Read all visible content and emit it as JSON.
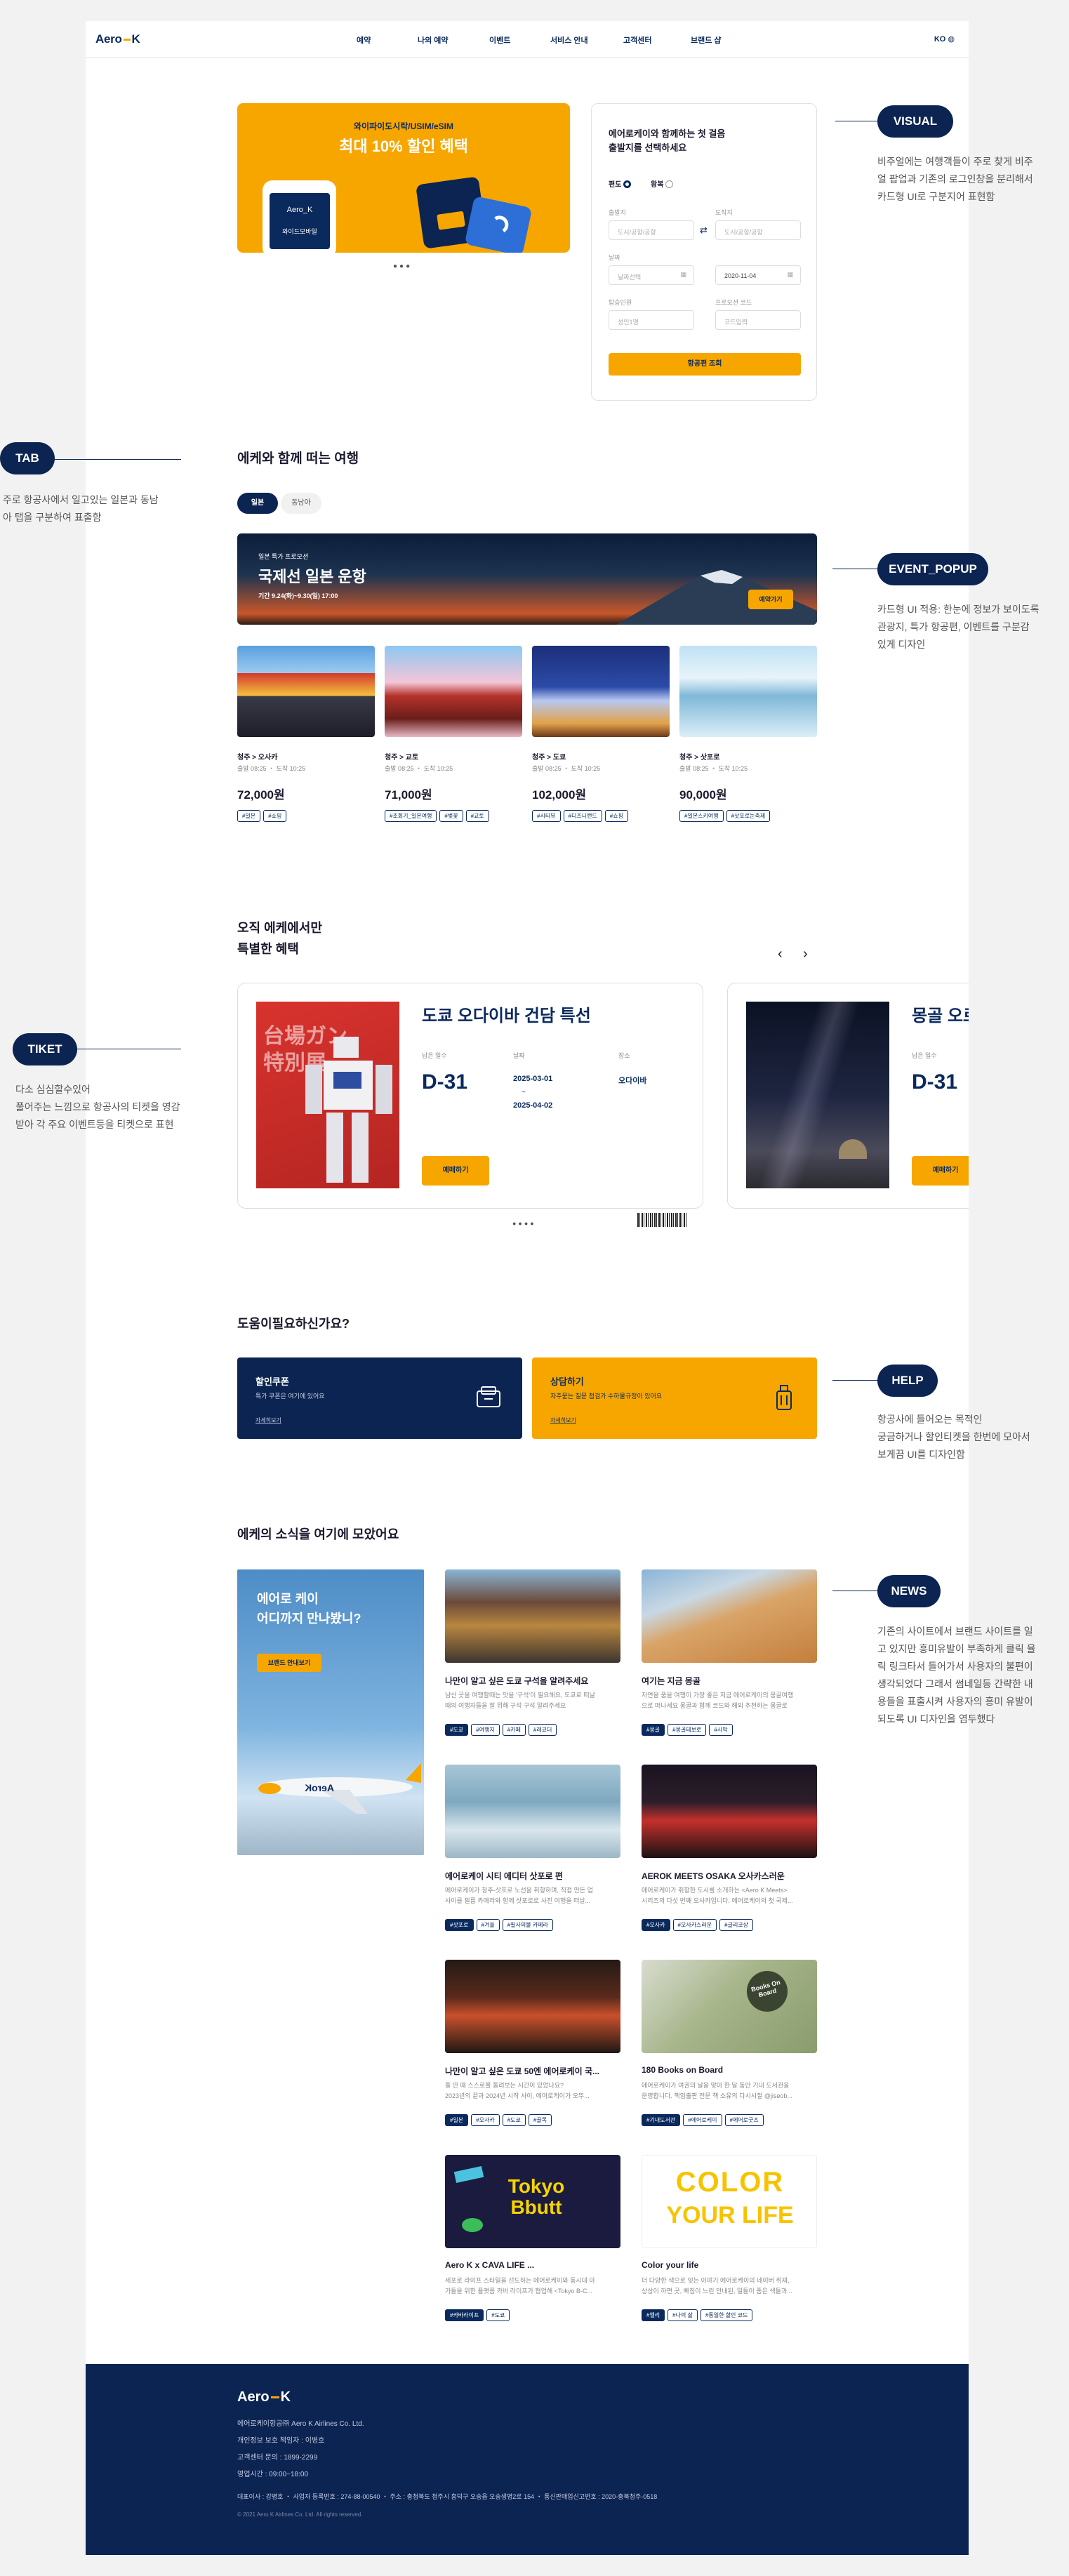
{
  "nav": {
    "logo_left": "Aero",
    "logo_right": "K",
    "menu": [
      "예약",
      "나의 예약",
      "이벤트",
      "서비스 안내",
      "고객센터",
      "브랜드 샵"
    ],
    "lang": "KO"
  },
  "banner": {
    "subtitle": "와이파이도시락/USIM/eSIM",
    "title": "최대 10% 할인 혜택",
    "phone_label_top": "Aero_K",
    "phone_label_bottom": "와이드모바일"
  },
  "booking": {
    "title_line1": "에어로케이와 함께하는 첫 걸음",
    "title_line2": "출발지를 선택하세요",
    "trip_oneway": "편도",
    "trip_round": "왕복",
    "from_label": "출발지",
    "from_placeholder": "도시/공항/공항",
    "to_label": "도착지",
    "to_placeholder": "도시/공항/공항",
    "date_label": "날짜",
    "date1": "날짜선택",
    "date2": "2020-11-04",
    "pax_label": "탑승인원",
    "pax_value": "성인1명",
    "promo_label": "프로모션 코드",
    "promo_value": "코드입력",
    "submit": "항공편 조회"
  },
  "trips": {
    "heading": "에케와 함께 떠는 여행",
    "tabs": [
      "일본",
      "동남아"
    ],
    "event": {
      "badge": "일본 특가 프로모션",
      "title": "국제선 일본 운항",
      "period": "기간 9.24(화)~9.30(일) 17:00",
      "button": "예약가기"
    },
    "cards": [
      {
        "route": "청주 > 오사카",
        "time": "출발 08:25 ・ 도착 10:25",
        "price": "72,000원",
        "tags": [
          "#일본",
          "#쇼핑"
        ]
      },
      {
        "route": "청주 > 교토",
        "time": "출발 08:25 ・ 도착 10:25",
        "price": "71,000원",
        "tags": [
          "#조회기_일본여행",
          "#벚꽃",
          "#교토"
        ]
      },
      {
        "route": "청주 > 도쿄",
        "time": "출발 08:25 ・ 도착 10:25",
        "price": "102,000원",
        "tags": [
          "#시티뷰",
          "#디즈니랜드",
          "#쇼핑"
        ]
      },
      {
        "route": "청주 > 삿포로",
        "time": "출발 08:25 ・ 도착 10:25",
        "price": "90,000원",
        "tags": [
          "#일본스키여행",
          "#삿포로눈축제"
        ]
      }
    ]
  },
  "special": {
    "heading_line1": "오직 에케에서만",
    "heading_line2": "특별한 혜택",
    "ticket1": {
      "title": "도쿄 오다이바 건담 특선",
      "poster_text_1": "台場ガン",
      "poster_text_2": "特別展",
      "days_label": "남은 일수",
      "days": "D-31",
      "date_label": "날짜",
      "date_start": "2025-03-01",
      "date_sep": "~",
      "date_end": "2025-04-02",
      "place_label": "장소",
      "place": "오다이바",
      "button": "예매하기"
    },
    "ticket2": {
      "title": "몽골 오로",
      "days_label": "남은 일수",
      "days": "D-31",
      "button": "예매하기"
    }
  },
  "help": {
    "heading": "도움이필요하신가요?",
    "coupon": {
      "title": "할인쿠폰",
      "desc": "특가 쿠폰은 여기에 있어요",
      "link": "자세히보기"
    },
    "consult": {
      "title": "상담하기",
      "desc": "자주묻는 질문 점검가 수하물규정이 있어요",
      "link": "자세히보기"
    }
  },
  "news": {
    "heading": "에케의 소식을 여기에 모았어요",
    "promo": {
      "line1": "에어로 케이",
      "line2": "어디까지 만나봤니?",
      "button": "브랜드 안내보기",
      "plane_text": "AeroK"
    },
    "items": [
      {
        "title": "나만이 알고 싶은 도쿄 구석을 알려주세요",
        "desc1": "남산 곳을 여행할때는 맛을 '구석'이 필요해요, 도쿄로 떠날",
        "desc2": "때의 여행자들을 잘 위해 구석 구석 알려주세요",
        "tags": [
          "#도쿄",
          "#여행지",
          "#카페",
          "#레코더"
        ]
      },
      {
        "title": "여기는 지금 몽골",
        "desc1": "자연을 품을 여행이 가장 좋은 지금 에어로케이의 몽골여행",
        "desc2": "으로 떠나세요 몽골과 함께 코드와 해외 추천하는 몽골로",
        "tags": [
          "#몽골",
          "#몽골테보로",
          "#사막"
        ]
      },
      {
        "title": "에어로케이 시티 에디터 삿포로 편",
        "desc1": "에어로케이가 청주-삿포로 노선을 취항하며, 직접 만든 업",
        "desc2": "사이를 필름 카메라와 함께 삿포로로 사진 여행을 떠날...",
        "tags": [
          "#삿포로",
          "#겨울",
          "#필사의물 카메라"
        ]
      },
      {
        "title": "AEROK MEETS OSAKA 오사카스러운",
        "desc1": "에어로케이가 취항한 도시를 소개하는 <Aero K Meets>",
        "desc2": "시리즈의 다섯 번째 오사카입니다. 에어로케이의 첫 국제...",
        "tags": [
          "#오사카",
          "#오사카스러운",
          "#글리코상"
        ]
      },
      {
        "title": "나만이 알고 싶은 도쿄 50엔 에어로케이 국...",
        "desc1": "둘 만 때 스스로를 돌려보는 시간이 있었나요?",
        "desc2": "2023년의 끝과 2024년 시작 사이, 에어로케이가 오뚜...",
        "tags": [
          "#일본",
          "#오사카",
          "#도쿄",
          "#골목"
        ]
      },
      {
        "title": "180 Books on Board",
        "desc1": "에어로케이가 여권의 날을 맞아 한 달 동안 기내 도서관을",
        "desc2": "운영합니다. 책임출판 전문 책 소유의 다시시절 @jiseob...",
        "tags": [
          "#기내도서관",
          "#에어로케이",
          "#에어로굿즈"
        ]
      },
      {
        "title": "Aero K x CAVA LIFE ...",
        "desc1": "세포로 라이프 스타일을 선도하는 에어로케이와 동시대 아",
        "desc2": "가들을 위한 플랫폼 카바 라이프가 협업해 <Tokyo B-C...",
        "tags": [
          "#카바라이프",
          "#도쿄"
        ]
      },
      {
        "title": "Color your life",
        "desc1": "더 다양한 색으로 잊는 이야기 에어로케이의 네이버 취재,",
        "desc2": "상상이 하면 곳, 빠짐이 느린 안내된, 일들이 품은 색들과...",
        "tags": [
          "#앨리",
          "#나의 삶",
          "#통일한 할인 코드"
        ]
      }
    ],
    "tokyo_text": "Tokyo Bbutt",
    "color_text_1": "COLOR",
    "color_text_2": "YOUR LIFE",
    "books_text": "Books On Board"
  },
  "footer": {
    "logo_left": "Aero",
    "logo_right": "K",
    "company": "에어로케이항공㈜ Aero K Airlines Co. Ltd.",
    "privacy": "개인정보 보호 책임자 : 이병호",
    "phone": "고객센터 문의 : 1899-2299",
    "hours": "영업시간 : 09:00~18:00",
    "address": "대표이사 : 강병호 ・ 사업자 등록번호 : 274-88-00540 ・ 주소 : 충청북도 청주시 흥덕구 오송읍 오송생명2로 154 ・ 통신판매업신고번호 : 2020-충북청주-0518",
    "copyright": "© 2021 Aero K Airlines Co. Ltd. All rights reserved."
  },
  "annotations": [
    {
      "label": "VISUAL",
      "text1": "비주얼에는 여행객들이 주로 찾게 비주",
      "text2": "얼 팝업과 기존의 로그인창을 분리해서",
      "text3": "카드형 UI로 구분지어 표현함",
      "text4": "",
      "text5": "",
      "text6": ""
    },
    {
      "label": "TAB",
      "text1": "주로 항공사에서 일고있는 일본과 동남",
      "text2": "아 탭을 구분하여 표출함",
      "text3": "",
      "text4": "",
      "text5": "",
      "text6": ""
    },
    {
      "label": "EVENT_POPUP",
      "text1": "카드형 UI 적용: 한눈에 정보가 보이도록",
      "text2": "관광지, 특가 항공편, 이벤트를 구분감",
      "text3": "있게 디자인",
      "text4": "",
      "text5": "",
      "text6": ""
    },
    {
      "label": "TIKET",
      "text1": "다소 심심할수있어",
      "text2": "풀어주는 느낌으로 항공사의 티켓을 영감",
      "text3": "받아 각 주요 이벤트등을 티켓으로 표현",
      "text4": "",
      "text5": "",
      "text6": ""
    },
    {
      "label": "HELP",
      "text1": "항공사에 들어오는 목적인",
      "text2": "궁금하거나 할인티켓을 한번에 모아서",
      "text3": "보게끔 UI를 디자인함",
      "text4": "",
      "text5": "",
      "text6": ""
    },
    {
      "label": "NEWS",
      "text1": "기존의 사이트에서 브랜드 사이트를 일",
      "text2": "고 있지만 흥미유발이 부족하게 클릭 율",
      "text3": "릭 링크타서 들어가서 사용자의 불편이",
      "text4": "생각되었다 그래서 썸네일등 간략한 내",
      "text5": "용들을 표출시켜 사용자의 흥미 유발이",
      "text6": "되도록 UI 디자인을 염두했다"
    }
  ]
}
